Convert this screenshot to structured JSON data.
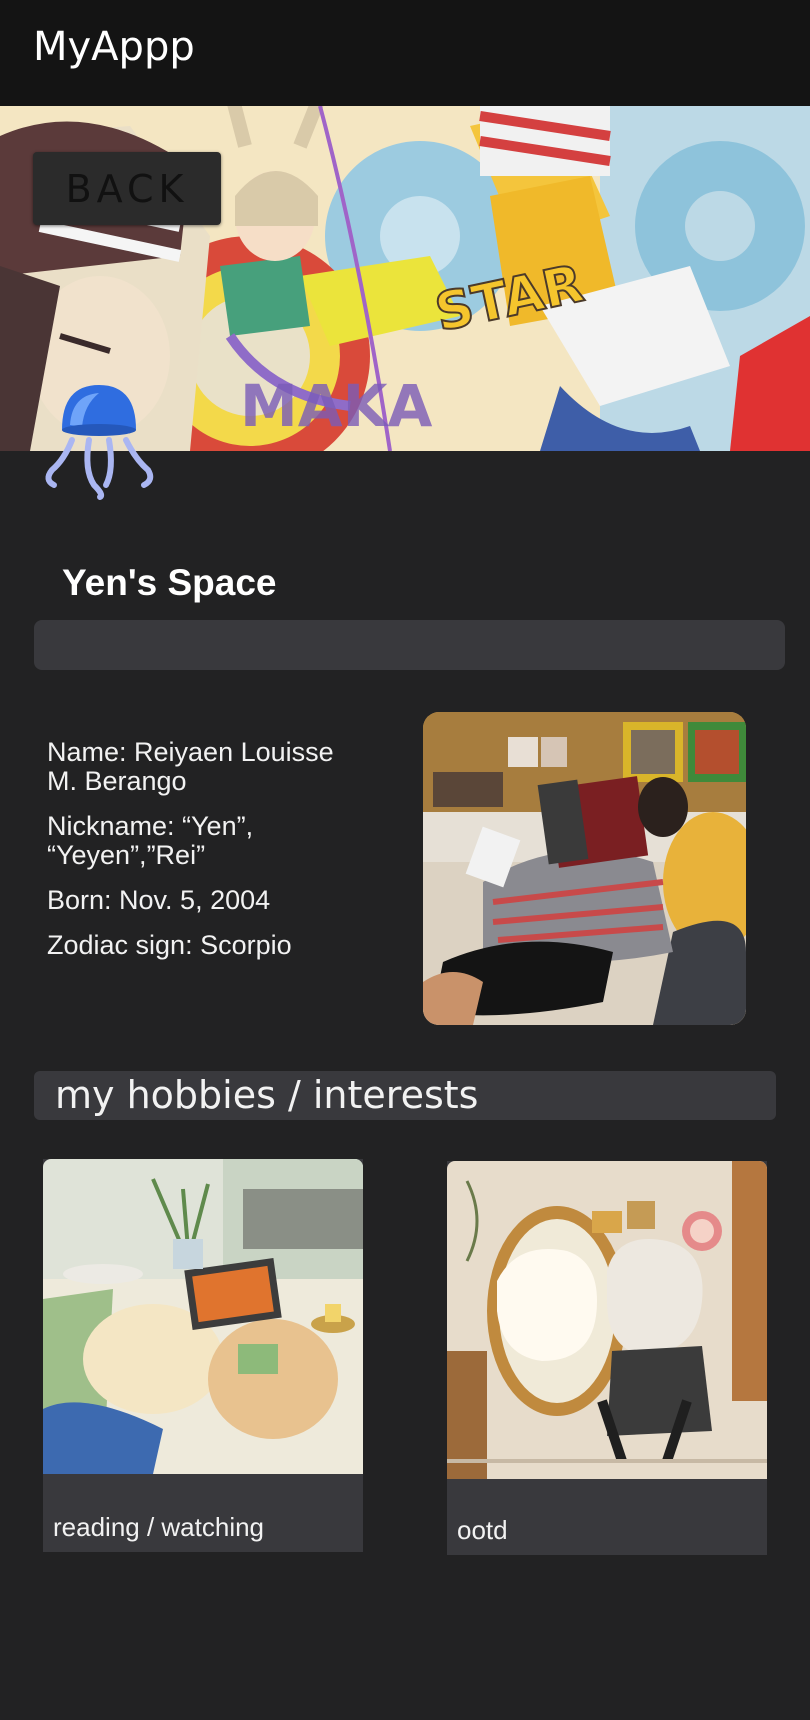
{
  "app": {
    "title": "MyAppp"
  },
  "banner": {
    "back_label": "BACK"
  },
  "profile": {
    "title": "Yen's Space",
    "name": "Name: Reiyaen Louisse M. Berango",
    "nickname": "Nickname: “Yen”, “Yeyen”,”Rei”",
    "born": "Born: Nov. 5, 2004",
    "zodiac": "Zodiac sign: Scorpio"
  },
  "hobbies": {
    "title": "my hobbies / interests",
    "cards": [
      {
        "label": "reading / watching"
      },
      {
        "label": "ootd"
      }
    ]
  }
}
